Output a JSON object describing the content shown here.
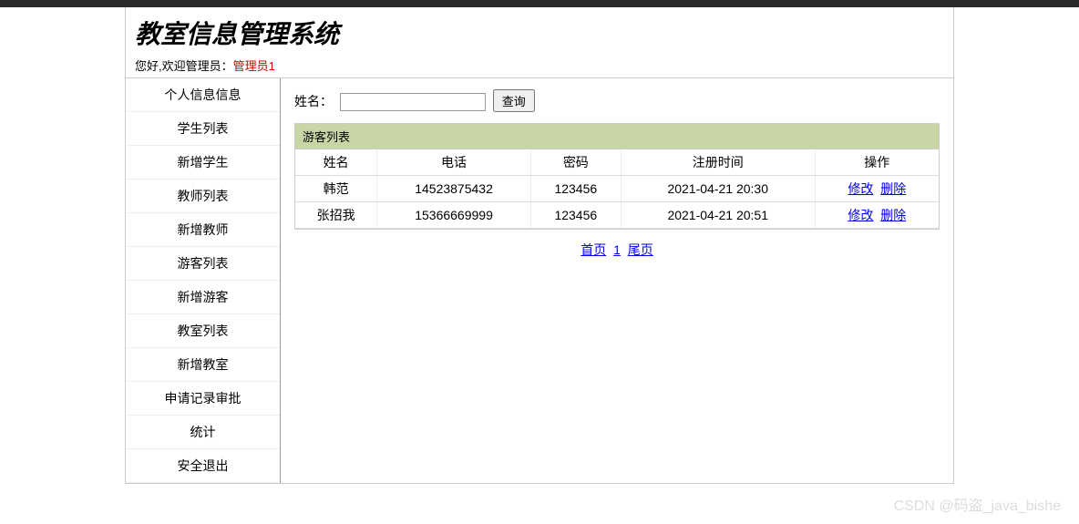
{
  "header": {
    "title": "教室信息管理系统",
    "welcome_prefix": "您好,欢迎管理员：",
    "admin_name": "管理员1"
  },
  "sidebar": {
    "items": [
      {
        "label": "个人信息信息"
      },
      {
        "label": "学生列表"
      },
      {
        "label": "新增学生"
      },
      {
        "label": "教师列表"
      },
      {
        "label": "新增教师"
      },
      {
        "label": "游客列表"
      },
      {
        "label": "新增游客"
      },
      {
        "label": "教室列表"
      },
      {
        "label": "新增教室"
      },
      {
        "label": "申请记录审批"
      },
      {
        "label": "统计"
      },
      {
        "label": "安全退出"
      }
    ]
  },
  "search": {
    "label": "姓名：",
    "button": "查询"
  },
  "table": {
    "title": "游客列表",
    "headers": [
      "姓名",
      "电话",
      "密码",
      "注册时间",
      "操作"
    ],
    "rows": [
      {
        "name": "韩范",
        "phone": "14523875432",
        "password": "123456",
        "time": "2021-04-21 20:30"
      },
      {
        "name": "张招我",
        "phone": "15366669999",
        "password": "123456",
        "time": "2021-04-21 20:51"
      }
    ],
    "actions": {
      "edit": "修改",
      "delete": "删除"
    }
  },
  "pagination": {
    "first": "首页",
    "page": "1",
    "last": "尾页"
  },
  "watermark": "CSDN @码盗_java_bishe"
}
